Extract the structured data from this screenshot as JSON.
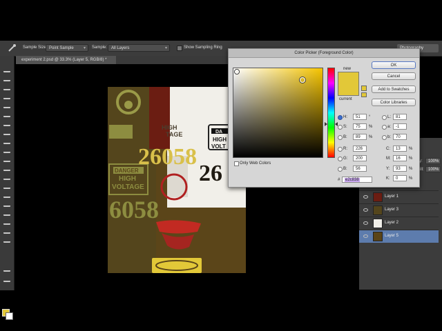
{
  "options_bar": {
    "sample_size_label": "Sample Size:",
    "sample_size_value": "Point Sample",
    "sample_label": "Sample:",
    "sample_value": "All Layers",
    "show_ring_label": "Show Sampling Ring",
    "workspace": "Photography"
  },
  "document": {
    "tab_title": "experiment 2.psd @ 33.3% (Layer 5, RGB/8) *"
  },
  "canvas_text": {
    "number_big": "26058",
    "number_left": "6058",
    "number_right": "26",
    "danger_1": "DANGER",
    "high_1": "HIGH",
    "voltage_1": "VOLTAGE",
    "danger_2": "DA",
    "high_2": "HIGH",
    "voltage_2": "VOLT",
    "high_3": "HIGH",
    "tage_3": "TAGE"
  },
  "dialog": {
    "title": "Color Picker (Foreground Color)",
    "new_label": "new",
    "current_label": "current",
    "buttons": {
      "ok": "OK",
      "cancel": "Cancel",
      "add_swatches": "Add to Swatches",
      "color_libraries": "Color Libraries"
    },
    "only_web_colors": "Only Web Colors",
    "hsb": [
      {
        "label": "H:",
        "value": "51",
        "unit": "°"
      },
      {
        "label": "S:",
        "value": "75",
        "unit": "%"
      },
      {
        "label": "B:",
        "value": "89",
        "unit": "%"
      }
    ],
    "rgb": [
      {
        "label": "R:",
        "value": "226"
      },
      {
        "label": "G:",
        "value": "200"
      },
      {
        "label": "B:",
        "value": "56"
      }
    ],
    "lab": [
      {
        "label": "L:",
        "value": "81"
      },
      {
        "label": "a:",
        "value": "-1"
      },
      {
        "label": "b:",
        "value": "70"
      }
    ],
    "cmyk": [
      {
        "label": "C:",
        "value": "13",
        "unit": "%"
      },
      {
        "label": "M:",
        "value": "16",
        "unit": "%"
      },
      {
        "label": "Y:",
        "value": "93",
        "unit": "%"
      },
      {
        "label": "K:",
        "value": "0",
        "unit": "%"
      }
    ],
    "hex_label": "#",
    "hex_value": "e2c838",
    "selected_color": "#e2c838"
  },
  "panel": {
    "opacity_label": "ity:",
    "opacity_value": "100%",
    "fill_label": "ill:",
    "fill_value": "100%"
  },
  "layers": [
    {
      "name": "Layer 1",
      "selected": false
    },
    {
      "name": "Layer 3",
      "selected": false
    },
    {
      "name": "Layer 2",
      "selected": false
    },
    {
      "name": "Layer 5",
      "selected": true
    }
  ]
}
